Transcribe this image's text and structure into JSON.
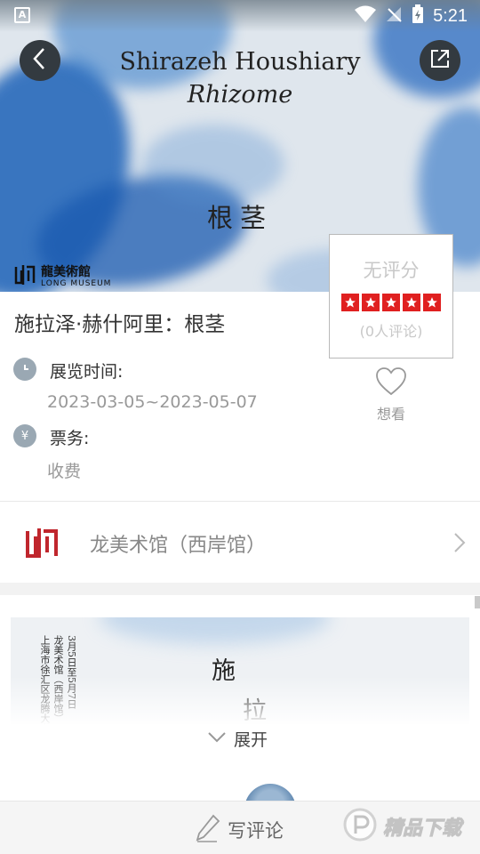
{
  "status_bar": {
    "time": "5:21",
    "left_badge": "A"
  },
  "banner": {
    "title_en": "Shirazeh Houshiary",
    "subtitle_en": "Rhizome",
    "title_cn": "根茎",
    "museum_logo_cn": "龍美術館",
    "museum_logo_en": "LONG MUSEUM"
  },
  "rating": {
    "title": "无评分",
    "stars": 5,
    "count_text": "(0人评论)"
  },
  "exhibition": {
    "title": "施拉泽·赫什阿里：根茎",
    "time_label": "展览时间:",
    "time_value": "2023-03-05~2023-05-07",
    "ticket_label": "票务:",
    "ticket_value": "收费",
    "want_label": "想看"
  },
  "venue": {
    "name": "龙美术馆（西岸馆）"
  },
  "poster": {
    "columns": [
      "3月5日至5月7日",
      "龙美术馆（西岸馆）",
      "上海市徐汇区龙腾大道"
    ],
    "big_chars": [
      "施",
      "拉"
    ],
    "expand_label": "展开"
  },
  "bottom_bar": {
    "write_review": "写评论"
  },
  "watermark": {
    "text": "精品下载"
  },
  "colors": {
    "accent_red": "#e02020",
    "logo_red": "#c0262d",
    "icon_gray": "#9aa8b3"
  }
}
